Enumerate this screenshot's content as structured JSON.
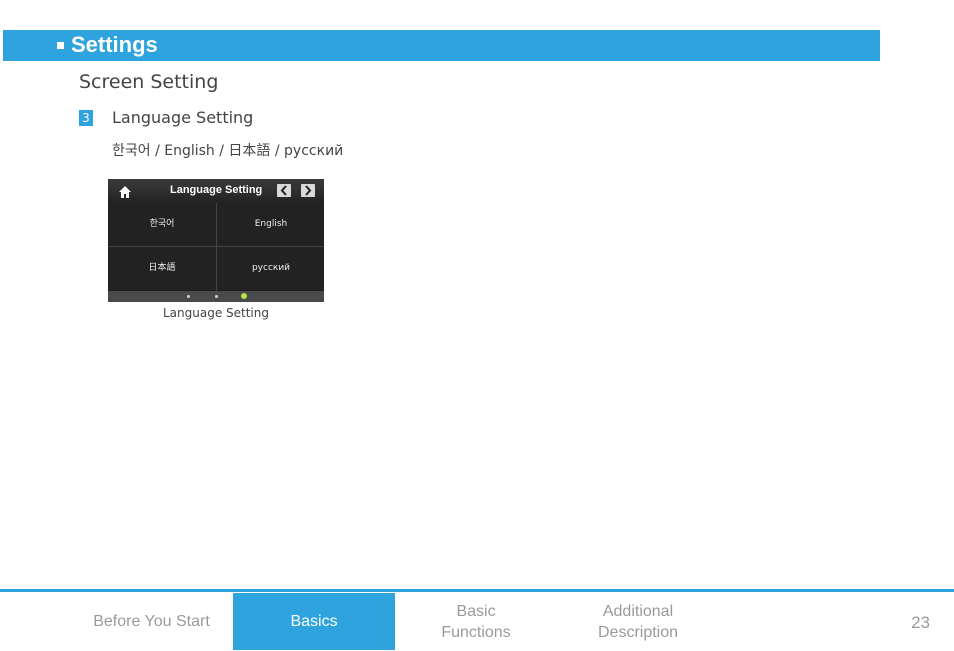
{
  "header": {
    "title": "Settings"
  },
  "section": {
    "title": "Screen Setting"
  },
  "item": {
    "number": "3",
    "title": "Language Setting",
    "languages_text": "한국어 / English / 日本語 / русский"
  },
  "device": {
    "title": "Language Setting",
    "cells": [
      "한국어",
      "English",
      "日本語",
      "русский"
    ],
    "page_dots": 3,
    "active_dot": 3
  },
  "caption": "Language Setting",
  "footer": {
    "tabs": [
      "Before You Start",
      "Basics",
      "Basic\nFunctions",
      "Additional\nDescription"
    ],
    "active_tab": "Basics",
    "page_number": "23"
  },
  "colors": {
    "accent": "#2ea3dd",
    "active_dot": "#b9e34b"
  }
}
